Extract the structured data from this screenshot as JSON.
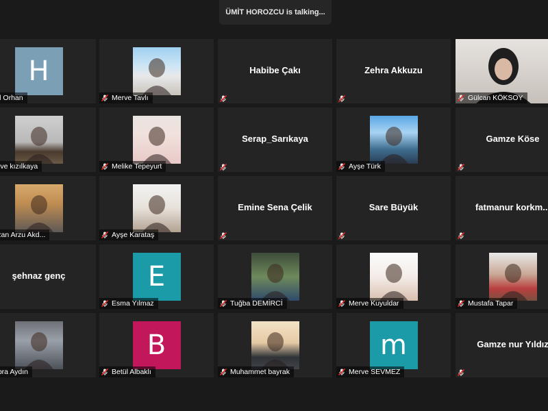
{
  "speaker_banner": "ÜMİT HOROZCU is talking...",
  "colors": {
    "accent_muted": "#e02828",
    "tile_bg": "#242424"
  },
  "participants": [
    {
      "row": 0,
      "col": 0,
      "name": "lal Orhan",
      "type": "letter",
      "letter": "H",
      "letter_bg": "#7ba0b6"
    },
    {
      "row": 0,
      "col": 1,
      "name": "Merve Tavlı",
      "type": "photo"
    },
    {
      "row": 0,
      "col": 2,
      "name": "Habibe Çakı",
      "type": "name"
    },
    {
      "row": 0,
      "col": 3,
      "name": "Zehra Akkuzu",
      "type": "name"
    },
    {
      "row": 0,
      "col": 4,
      "name": "Gülcan KÖKSOY",
      "type": "video"
    },
    {
      "row": 1,
      "col": 0,
      "name": "erve kızılkaya",
      "type": "photo"
    },
    {
      "row": 1,
      "col": 1,
      "name": "Melike Tepeyurt",
      "type": "photo"
    },
    {
      "row": 1,
      "col": 2,
      "name": "Serap_Sarıkaya",
      "type": "name"
    },
    {
      "row": 1,
      "col": 3,
      "name": "Ayşe Türk",
      "type": "photo"
    },
    {
      "row": 1,
      "col": 4,
      "name": "Gamze Köse",
      "type": "name"
    },
    {
      "row": 2,
      "col": 0,
      "name": "yzan Arzu Akd...",
      "type": "photo"
    },
    {
      "row": 2,
      "col": 1,
      "name": "Ayşe  Karataş",
      "type": "photo"
    },
    {
      "row": 2,
      "col": 2,
      "name": "Emine Sena Çelik",
      "type": "name"
    },
    {
      "row": 2,
      "col": 3,
      "name": "Sare Büyük",
      "type": "name"
    },
    {
      "row": 2,
      "col": 4,
      "name": "fatmanur  korkm...",
      "type": "name"
    },
    {
      "row": 3,
      "col": 0,
      "name": "şehnaz genç",
      "type": "name"
    },
    {
      "row": 3,
      "col": 1,
      "name": "Esma Yılmaz",
      "type": "letter",
      "letter": "E",
      "letter_bg": "#1b9aa8"
    },
    {
      "row": 3,
      "col": 2,
      "name": "Tuğba DEMİRCİ",
      "type": "photo"
    },
    {
      "row": 3,
      "col": 3,
      "name": "Merve Kuyuldar",
      "type": "photo"
    },
    {
      "row": 3,
      "col": 4,
      "name": "Mustafa Tapar",
      "type": "photo"
    },
    {
      "row": 4,
      "col": 0,
      "name": "übra Aydın",
      "type": "photo"
    },
    {
      "row": 4,
      "col": 1,
      "name": "Betül Albaklı",
      "type": "letter",
      "letter": "B",
      "letter_bg": "#c2185b"
    },
    {
      "row": 4,
      "col": 2,
      "name": "Muhammet bayrak",
      "type": "photo"
    },
    {
      "row": 4,
      "col": 3,
      "name": "Merve SEVMEZ",
      "type": "letter",
      "letter": "m",
      "letter_bg": "#1b9aa8"
    },
    {
      "row": 4,
      "col": 4,
      "name": "Gamze nur Yıldız",
      "type": "name"
    }
  ]
}
